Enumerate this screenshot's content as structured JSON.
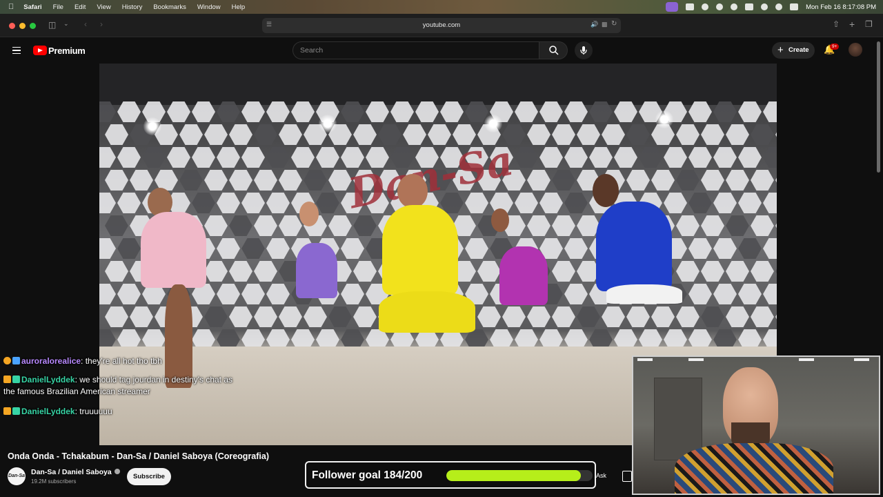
{
  "menubar": {
    "app": "Safari",
    "items": [
      "File",
      "Edit",
      "View",
      "History",
      "Bookmarks",
      "Window",
      "Help"
    ],
    "clock": "Mon Feb 16  8:17:08 PM"
  },
  "browser": {
    "url": "youtube.com"
  },
  "youtube": {
    "brand": "Premium",
    "search_placeholder": "Search",
    "create_label": "Create",
    "notifications_badge": "9+"
  },
  "video": {
    "wall_logo": "Dan-Sa",
    "title": "Onda Onda - Tchakabum - Dan-Sa / Daniel Saboya (Coreografia)",
    "channel": "Dan-Sa / Daniel Saboya",
    "channel_avatar_text": "Dan-Sa",
    "subscribers": "19.2M subscribers",
    "subscribe_label": "Subscribe",
    "ask_label": "Ask"
  },
  "chat": [
    {
      "user": "auroralorealice",
      "message": "they're all hot tho tbh",
      "badge_color": "#f5a623"
    },
    {
      "user": "DanielLyddek",
      "message": "we should tag jourdan in destiny's chat as",
      "continuation": "the famous Brazilian American streamer",
      "badge_color": "#f5a623"
    },
    {
      "user": "DanielLyddek",
      "message": "truuuuuu",
      "badge_color": "#f5a623"
    }
  ],
  "follower_goal": {
    "label": "Follower goal 184/200",
    "current": 184,
    "target": 200,
    "bar_color": "#b6ee1a"
  },
  "colors": {
    "youtube_red": "#ff0000",
    "chat_username": "#37d4a5",
    "notification_badge": "#cc0000"
  }
}
